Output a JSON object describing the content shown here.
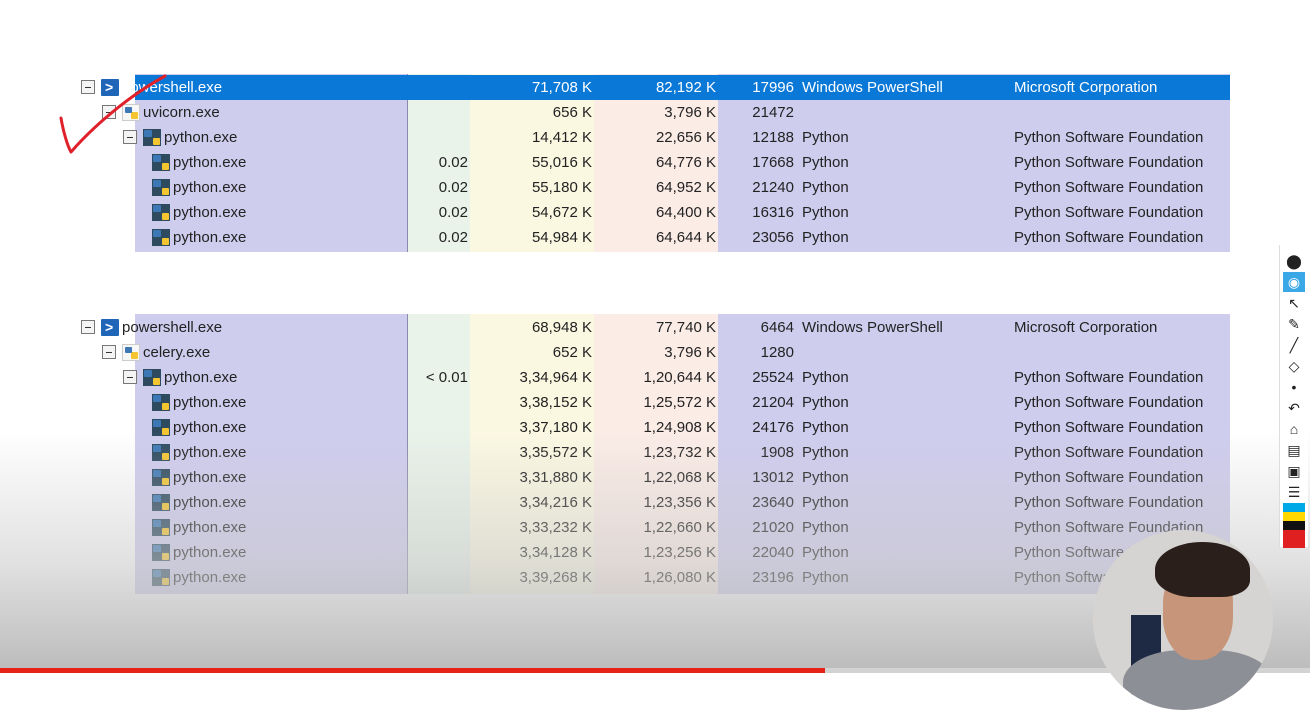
{
  "table1": {
    "rows": [
      {
        "name": "powershell.exe",
        "icon": "powershell-icon",
        "indent": 0,
        "toggle": true,
        "cpu": "",
        "private": "71,708 K",
        "working": "82,192 K",
        "pid": "17996",
        "description": "Windows PowerShell",
        "company": "Microsoft Corporation",
        "selected": true
      },
      {
        "name": "uvicorn.exe",
        "icon": "python-launcher-icon",
        "indent": 1,
        "toggle": true,
        "cpu": "",
        "private": "656 K",
        "working": "3,796 K",
        "pid": "21472",
        "description": "",
        "company": ""
      },
      {
        "name": "python.exe",
        "icon": "python-icon",
        "indent": 2,
        "toggle": true,
        "cpu": "",
        "private": "14,412 K",
        "working": "22,656 K",
        "pid": "12188",
        "description": "Python",
        "company": "Python Software Foundation"
      },
      {
        "name": "python.exe",
        "icon": "python-icon",
        "indent": 3,
        "toggle": false,
        "cpu": "0.02",
        "private": "55,016 K",
        "working": "64,776 K",
        "pid": "17668",
        "description": "Python",
        "company": "Python Software Foundation"
      },
      {
        "name": "python.exe",
        "icon": "python-icon",
        "indent": 3,
        "toggle": false,
        "cpu": "0.02",
        "private": "55,180 K",
        "working": "64,952 K",
        "pid": "21240",
        "description": "Python",
        "company": "Python Software Foundation"
      },
      {
        "name": "python.exe",
        "icon": "python-icon",
        "indent": 3,
        "toggle": false,
        "cpu": "0.02",
        "private": "54,672 K",
        "working": "64,400 K",
        "pid": "16316",
        "description": "Python",
        "company": "Python Software Foundation"
      },
      {
        "name": "python.exe",
        "icon": "python-icon",
        "indent": 3,
        "toggle": false,
        "cpu": "0.02",
        "private": "54,984 K",
        "working": "64,644 K",
        "pid": "23056",
        "description": "Python",
        "company": "Python Software Foundation"
      }
    ]
  },
  "table2": {
    "rows": [
      {
        "name": "powershell.exe",
        "icon": "powershell-icon",
        "indent": 0,
        "toggle": true,
        "cpu": "",
        "private": "68,948 K",
        "working": "77,740 K",
        "pid": "6464",
        "description": "Windows PowerShell",
        "company": "Microsoft Corporation"
      },
      {
        "name": "celery.exe",
        "icon": "python-launcher-icon",
        "indent": 1,
        "toggle": true,
        "cpu": "",
        "private": "652 K",
        "working": "3,796 K",
        "pid": "1280",
        "description": "",
        "company": ""
      },
      {
        "name": "python.exe",
        "icon": "python-icon",
        "indent": 2,
        "toggle": true,
        "cpu": "< 0.01",
        "private": "3,34,964 K",
        "working": "1,20,644 K",
        "pid": "25524",
        "description": "Python",
        "company": "Python Software Foundation"
      },
      {
        "name": "python.exe",
        "icon": "python-icon",
        "indent": 3,
        "toggle": false,
        "cpu": "",
        "private": "3,38,152 K",
        "working": "1,25,572 K",
        "pid": "21204",
        "description": "Python",
        "company": "Python Software Foundation"
      },
      {
        "name": "python.exe",
        "icon": "python-icon",
        "indent": 3,
        "toggle": false,
        "cpu": "",
        "private": "3,37,180 K",
        "working": "1,24,908 K",
        "pid": "24176",
        "description": "Python",
        "company": "Python Software Foundation"
      },
      {
        "name": "python.exe",
        "icon": "python-icon",
        "indent": 3,
        "toggle": false,
        "cpu": "",
        "private": "3,35,572 K",
        "working": "1,23,732 K",
        "pid": "1908",
        "description": "Python",
        "company": "Python Software Foundation"
      },
      {
        "name": "python.exe",
        "icon": "python-icon",
        "indent": 3,
        "toggle": false,
        "cpu": "",
        "private": "3,31,880 K",
        "working": "1,22,068 K",
        "pid": "13012",
        "description": "Python",
        "company": "Python Software Foundation"
      },
      {
        "name": "python.exe",
        "icon": "python-icon",
        "indent": 3,
        "toggle": false,
        "cpu": "",
        "private": "3,34,216 K",
        "working": "1,23,356 K",
        "pid": "23640",
        "description": "Python",
        "company": "Python Software Foundation"
      },
      {
        "name": "python.exe",
        "icon": "python-icon",
        "indent": 3,
        "toggle": false,
        "cpu": "",
        "private": "3,33,232 K",
        "working": "1,22,660 K",
        "pid": "21020",
        "description": "Python",
        "company": "Python Software Foundation"
      },
      {
        "name": "python.exe",
        "icon": "python-icon",
        "indent": 3,
        "toggle": false,
        "cpu": "",
        "private": "3,34,128 K",
        "working": "1,23,256 K",
        "pid": "22040",
        "description": "Python",
        "company": "Python Software Foundation"
      },
      {
        "name": "python.exe",
        "icon": "python-icon",
        "indent": 3,
        "toggle": false,
        "cpu": "",
        "private": "3,39,268 K",
        "working": "1,26,080 K",
        "pid": "23196",
        "description": "Python",
        "company": "Python Software Foundation"
      }
    ]
  },
  "annotation": {
    "checkmark_color": "#e0202a"
  },
  "toolbar": {
    "icons": [
      "pen-logo-icon",
      "eye-icon",
      "cursor-icon",
      "highlighter-icon",
      "pen-icon",
      "eraser-icon",
      "dot-icon",
      "undo-icon",
      "trash-icon",
      "whiteboard-icon",
      "camera-icon",
      "clipboard-icon"
    ],
    "active_index": 1,
    "palette": [
      "#00a8e8",
      "#ffd800",
      "#111111",
      "#e02020",
      "#e02020"
    ]
  },
  "video": {
    "progress": 0.63,
    "progress_color": "#e62117"
  },
  "colors": {
    "name_bg": "#cfcdee",
    "cpu_bg": "#e9f3ea",
    "private_bg": "#fbf8e2",
    "working_bg": "#fbece6",
    "selected": "#0a78d7"
  }
}
